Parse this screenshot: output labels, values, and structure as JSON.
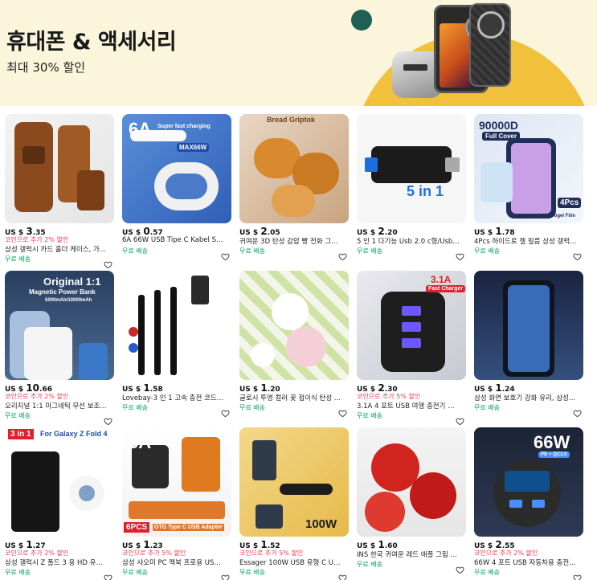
{
  "banner": {
    "title": "휴대폰 & 액세서리",
    "subtitle": "최대 30% 할인"
  },
  "currency_prefix": "US $",
  "products": [
    {
      "price_int": "3",
      "price_dec": ".35",
      "promo": "코인으로 추가 2% 할인",
      "title": "삼성 갤럭시 카드 홀더 케이스, 가...",
      "shipping": "무료 배송",
      "image": "brown-leather-phone-case"
    },
    {
      "price_int": "0",
      "price_dec": ".57",
      "promo": "",
      "title": "6A 66W USB Tipe C Kabel Super ...",
      "shipping": "무료 배송",
      "image": "white-usb-c-cable",
      "image_text": [
        "6A",
        "Super fast charging",
        "MAX66W"
      ]
    },
    {
      "price_int": "2",
      "price_dec": ".05",
      "promo": "",
      "title": "귀여운 3D 탄성 감압 빵 전화 그립 ...",
      "shipping": "무료 배송",
      "image": "bread-phone-grip",
      "image_text": [
        "Bread Griptok"
      ]
    },
    {
      "price_int": "2",
      "price_dec": ".20",
      "promo": "",
      "title": "5 인 1 다기능 Usb 2.0 c형/Usb/마...",
      "shipping": "무료 배송",
      "image": "5in1-card-reader",
      "image_text": [
        "5 in 1"
      ]
    },
    {
      "price_int": "1",
      "price_dec": ".78",
      "promo": "",
      "title": "4Pcs 하이드로 젤 필름 삼성 갤럭...",
      "shipping": "무료 배송",
      "image": "hydrogel-film",
      "image_text": [
        "90000D",
        "Full Cover",
        "4Pcs",
        "Hydrogel Film"
      ]
    },
    {
      "price_int": "10",
      "price_dec": ".66",
      "promo": "코인으로 추가 2% 할인",
      "title": "오리지널 1:1 마그네틱 무선 보조...",
      "shipping": "무료 배송",
      "image": "magnetic-power-bank",
      "image_text": [
        "Original 1:1",
        "Magnetic Power Bank",
        "5000mAh/10000mAh"
      ]
    },
    {
      "price_int": "1",
      "price_dec": ".58",
      "promo": "",
      "title": "Lovebay-3 인 1 고속 충전 코드, 마...",
      "shipping": "무료 배송",
      "image": "3in1-cable"
    },
    {
      "price_int": "1",
      "price_dec": ".20",
      "promo": "",
      "title": "글로시 투명 컬러 꽃 접이식 탄성 ...",
      "shipping": "무료 배송",
      "image": "flower-phone-grip"
    },
    {
      "price_int": "2",
      "price_dec": ".30",
      "promo": "코인으로 추가 5% 할인",
      "title": "3.1A 4 포트 USB 여행 충전기 QC ...",
      "shipping": "무료 배송",
      "image": "usb-wall-charger",
      "image_text": [
        "3.1A",
        "Fast Charger"
      ]
    },
    {
      "price_int": "1",
      "price_dec": ".24",
      "promo": "",
      "title": "삼성 화면 보호기 강화 유리, 삼성 ...",
      "shipping": "무료 배송",
      "image": "screen-protector"
    },
    {
      "price_int": "1",
      "price_dec": ".27",
      "promo": "코인으로 추가 2% 할인",
      "title": "삼성 갤럭시 Z 폴드 3 용 HD 유리, ...",
      "shipping": "무료 배송",
      "image": "fold-glass",
      "image_text": [
        "3 in 1",
        "For Galaxy Z Fold 4"
      ]
    },
    {
      "price_int": "1",
      "price_dec": ".23",
      "promo": "코인으로 추가 5% 할인",
      "title": "삼성 샤오미 PC 맥북 프로용 USB ...",
      "shipping": "무료 배송",
      "image": "otg-adapter",
      "image_text": [
        "6A",
        "6PCS",
        "OTG Type C USB Adapter"
      ]
    },
    {
      "price_int": "1",
      "price_dec": ".52",
      "promo": "코인으로 추가 5% 할인",
      "title": "Essager 100W USB 유형 C USB C ...",
      "shipping": "무료 배송",
      "image": "braided-usb-c-cable",
      "image_text": [
        "100W"
      ]
    },
    {
      "price_int": "1",
      "price_dec": ".60",
      "promo": "",
      "title": "INS 한국 귀여운 레드 애플 그립 톡...",
      "shipping": "무료 배송",
      "image": "red-apple-grip"
    },
    {
      "price_int": "2",
      "price_dec": ".55",
      "promo": "코인으로 추가 2% 할인",
      "title": "66W 4 포트 USB 자동차용 충전기, ...",
      "shipping": "무료 배송",
      "image": "car-charger",
      "image_text": [
        "66W",
        "PD + QC3.0"
      ]
    }
  ],
  "colors": {
    "promo": "#fd384f",
    "shipping": "#00a35b",
    "banner_bg": "#fbf5dc",
    "banner_accent": "#f2c13c"
  }
}
